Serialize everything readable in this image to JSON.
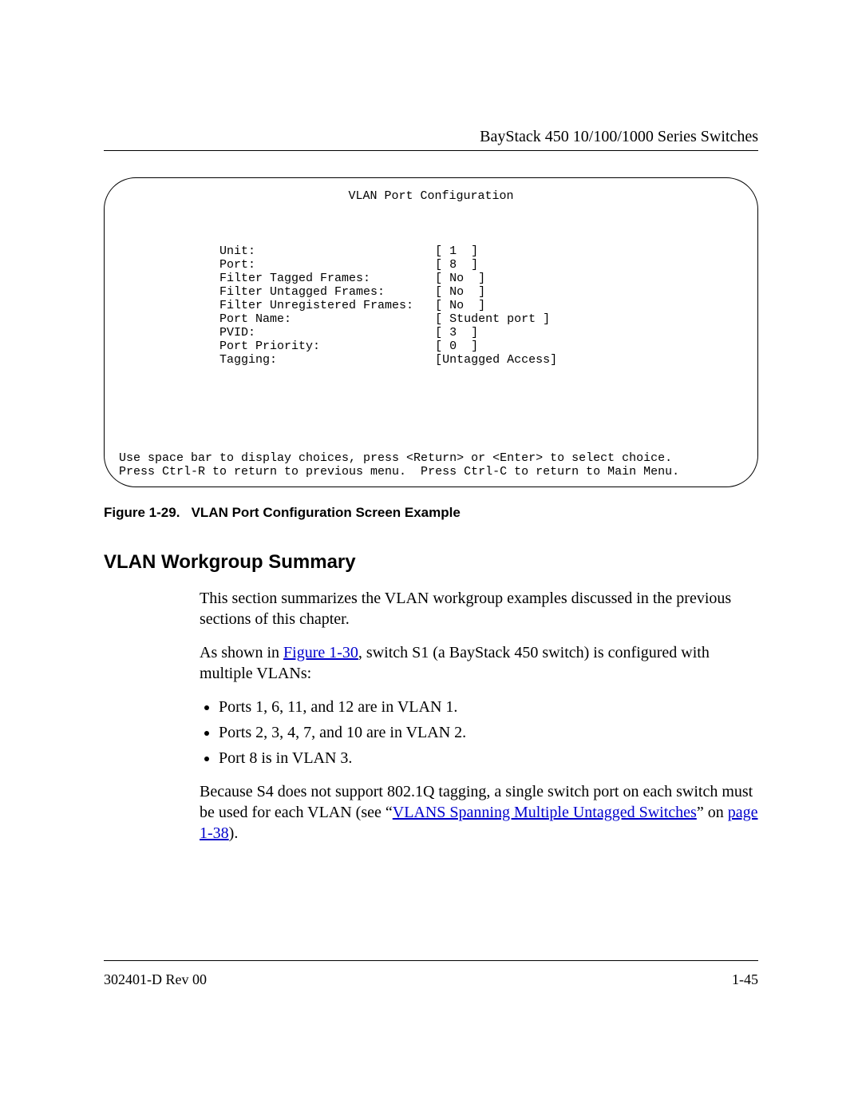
{
  "header": {
    "title": "BayStack 450 10/100/1000 Series Switches"
  },
  "screen": {
    "title": "VLAN Port Configuration",
    "rows": [
      {
        "label": "Unit:",
        "value": "[ 1  ]"
      },
      {
        "label": "Port:",
        "value": "[ 8  ]"
      },
      {
        "label": "Filter Tagged Frames:",
        "value": "[ No  ]"
      },
      {
        "label": "Filter Untagged Frames:",
        "value": "[ No  ]"
      },
      {
        "label": "Filter Unregistered Frames:",
        "value": "[ No  ]"
      },
      {
        "label": "Port Name:",
        "value": "[ Student port ]"
      },
      {
        "label": "PVID:",
        "value": "[ 3  ]"
      },
      {
        "label": "Port Priority:",
        "value": "[ 0  ]"
      },
      {
        "label": "Tagging:",
        "value": "[Untagged Access]"
      }
    ],
    "help1": "Use space bar to display choices, press <Return> or <Enter> to select choice.",
    "help2": "Press Ctrl-R to return to previous menu.  Press Ctrl-C to return to Main Menu."
  },
  "caption": {
    "label": "Figure 1-29.",
    "text": "VLAN Port Configuration Screen Example"
  },
  "section": {
    "heading": "VLAN Workgroup Summary",
    "p1": "This section summarizes the VLAN workgroup examples discussed in the previous sections of this chapter.",
    "p2a": "As shown in ",
    "p2_link": "Figure 1-30",
    "p2b": ", switch S1 (a BayStack 450 switch) is configured with multiple VLANs:",
    "bullets": [
      "Ports 1, 6, 11, and 12 are in VLAN 1.",
      "Ports 2, 3, 4, 7, and 10 are in VLAN 2.",
      "Port 8 is in VLAN 3."
    ],
    "p3a": "Because S4 does not support 802.1Q tagging, a single switch port on each switch must be used for each VLAN (see “",
    "p3_link1": "VLANS Spanning Multiple Untagged Switches",
    "p3b": "” on ",
    "p3_link2": "page 1-38",
    "p3c": ")."
  },
  "footer": {
    "docid": "302401-D Rev 00",
    "pagenum": "1-45"
  }
}
